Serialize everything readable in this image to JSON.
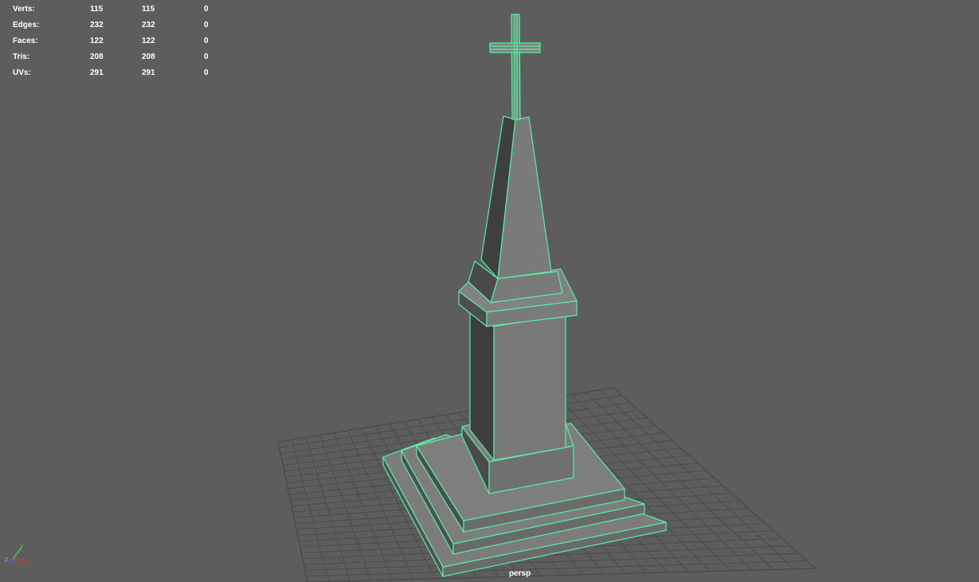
{
  "hud": {
    "rows": [
      {
        "label": "Verts:",
        "v1": "115",
        "v2": "115",
        "v3": "0"
      },
      {
        "label": "Edges:",
        "v1": "232",
        "v2": "232",
        "v3": "0"
      },
      {
        "label": "Faces:",
        "v1": "122",
        "v2": "122",
        "v3": "0"
      },
      {
        "label": "Tris:",
        "v1": "208",
        "v2": "208",
        "v3": "0"
      },
      {
        "label": "UVs:",
        "v1": "291",
        "v2": "291",
        "v3": "0"
      }
    ]
  },
  "viewport": {
    "camera": "persp",
    "background_color": "#5d5d5d",
    "wire_color": "#50f0a0",
    "grid_color": "#4a4a4a"
  },
  "axis": {
    "x_label": "x",
    "y_label": "y",
    "z_label": "z"
  }
}
